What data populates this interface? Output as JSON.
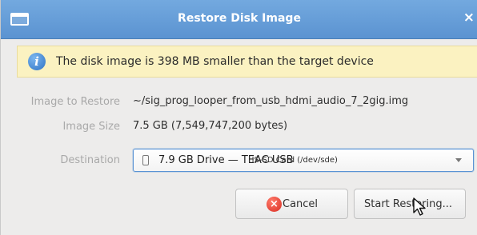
{
  "window": {
    "title": "Restore Disk Image",
    "close_glyph": "×",
    "menu_icon": "window-menu-icon"
  },
  "info": {
    "icon": "info-icon",
    "icon_glyph": "i",
    "message": "The disk image is 398 MB smaller than the target device"
  },
  "fields": {
    "image_label": "Image to Restore",
    "image_value": "~/sig_prog_looper_from_usb_hdmi_audio_7_2gig.img",
    "size_label": "Image Size",
    "size_value": "7.5 GB (7,549,747,200 bytes)",
    "destination_label": "Destination",
    "destination_main": "7.9 GB Drive — TEAC USB",
    "destination_detail": "HS-SD Card (/dev/sde)"
  },
  "buttons": {
    "cancel_label": "Cancel",
    "cancel_icon_glyph": "×",
    "start_label": "Start Restoring..."
  },
  "colors": {
    "titlebar": "#5b93d1",
    "info_bg": "#fbf2c1",
    "focus_border": "#5a93d4"
  }
}
